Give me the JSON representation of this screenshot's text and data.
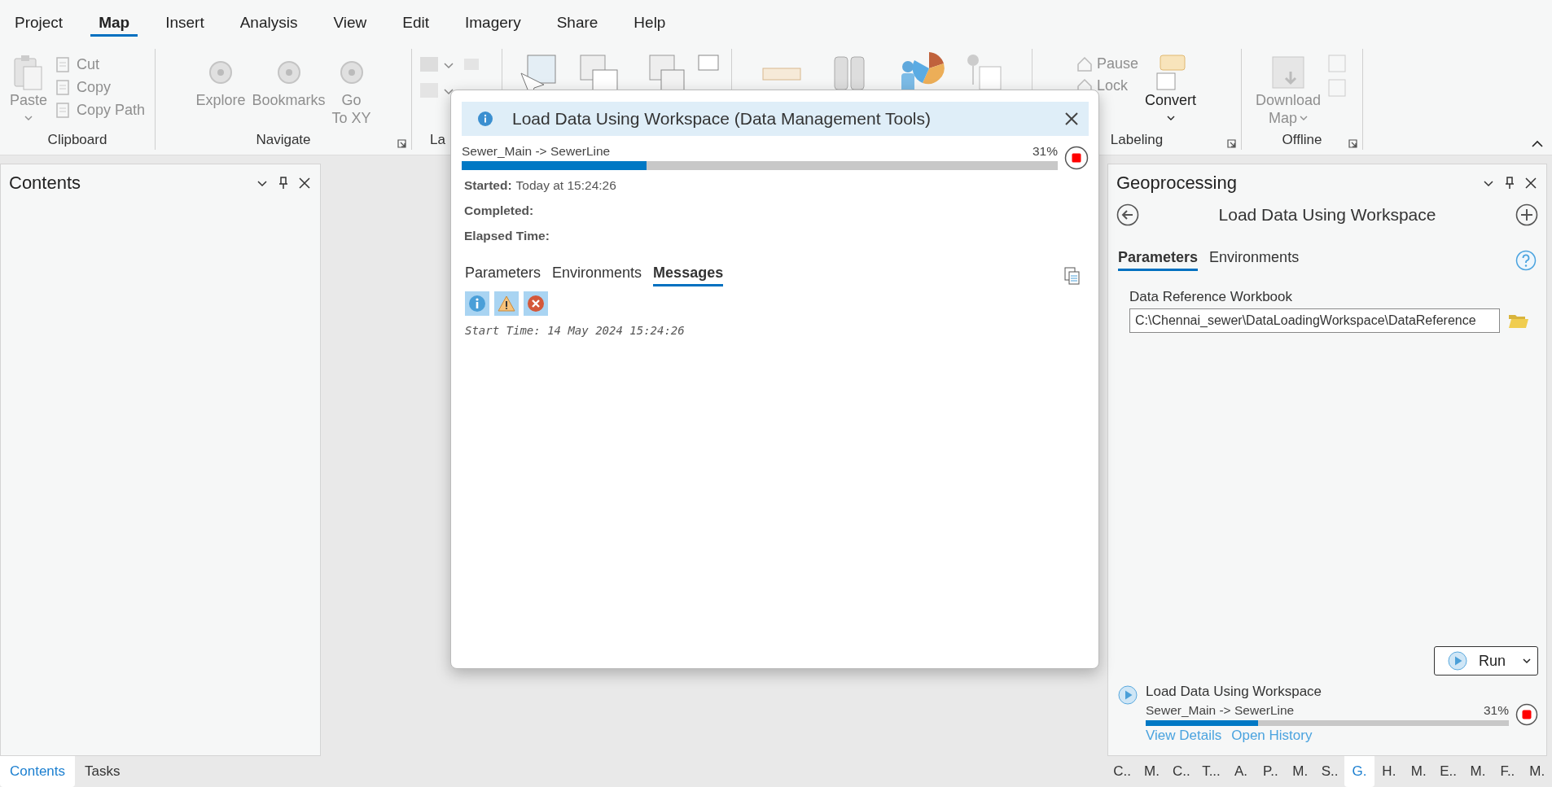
{
  "menu_tabs": [
    {
      "label": "Project",
      "selected": false
    },
    {
      "label": "Map",
      "selected": true
    },
    {
      "label": "Insert",
      "selected": false
    },
    {
      "label": "Analysis",
      "selected": false
    },
    {
      "label": "View",
      "selected": false
    },
    {
      "label": "Edit",
      "selected": false
    },
    {
      "label": "Imagery",
      "selected": false
    },
    {
      "label": "Share",
      "selected": false
    },
    {
      "label": "Help",
      "selected": false
    }
  ],
  "ribbon": {
    "clipboard": {
      "label": "Clipboard",
      "items": [
        {
          "label": "Paste",
          "disabled": true
        },
        {
          "label": "Cut",
          "disabled": true
        },
        {
          "label": "Copy",
          "disabled": true
        },
        {
          "label": "Copy Path",
          "disabled": true
        }
      ]
    },
    "navigate": {
      "label": "Navigate",
      "items": [
        {
          "lines": [
            "Explore"
          ],
          "disabled": true
        },
        {
          "lines": [
            "Bookmarks"
          ],
          "disabled": true
        },
        {
          "lines": [
            "Go",
            "To XY"
          ],
          "disabled": true
        }
      ]
    },
    "layer": {
      "label": "La"
    },
    "labeling": {
      "label": "Labeling",
      "items": [
        {
          "label": "Pause",
          "disabled": true
        },
        {
          "label": "Lock",
          "disabled": true
        },
        {
          "label": "Convert",
          "disabled": false
        }
      ]
    },
    "offline": {
      "label": "Offline",
      "items": [
        {
          "lines": [
            "Download",
            "Map"
          ],
          "disabled": true
        }
      ]
    }
  },
  "contents_pane": {
    "title": "Contents"
  },
  "dialog": {
    "title": "Load Data Using Workspace (Data Management Tools)",
    "task": "Sewer_Main -> SewerLine",
    "percent": "31%",
    "level": 0.31,
    "fields": [
      {
        "label": "Started:",
        "value": "Today at 15:24:26"
      },
      {
        "label": "Completed:"
      },
      {
        "label": "Elapsed Time:"
      }
    ],
    "tabs": [
      {
        "label": "Parameters",
        "selected": false
      },
      {
        "label": "Environments",
        "selected": false
      },
      {
        "label": "Messages",
        "selected": true
      }
    ],
    "filters": [
      {
        "kind": "info",
        "on": true
      },
      {
        "kind": "warning",
        "on": true
      },
      {
        "kind": "error",
        "on": true
      }
    ],
    "messages": [
      "Start Time: 14 May 2024 15:24:26"
    ]
  },
  "geoprocessing": {
    "title": "Geoprocessing",
    "tool": "Load Data Using Workspace",
    "tabs": [
      {
        "label": "Parameters",
        "selected": true
      },
      {
        "label": "Environments",
        "selected": false
      }
    ],
    "parameter": {
      "label": "Data Reference Workbook",
      "value": "C:\\Chennai_sewer\\DataLoadingWorkspace\\DataReference"
    },
    "run": "Run",
    "progress": {
      "tool": "Load Data Using Workspace",
      "task": "Sewer_Main -> SewerLine",
      "percent": "31%",
      "level": 0.31,
      "links": [
        "View Details",
        "Open History"
      ]
    }
  },
  "left_tabs": [
    {
      "label": "Contents",
      "selected": true
    },
    {
      "label": "Tasks",
      "selected": false
    }
  ],
  "right_tabs": [
    {
      "label": "C..",
      "selected": false
    },
    {
      "label": "M.",
      "selected": false
    },
    {
      "label": "C..",
      "selected": false
    },
    {
      "label": "T...",
      "selected": false
    },
    {
      "label": "A.",
      "selected": false
    },
    {
      "label": "P..",
      "selected": false
    },
    {
      "label": "M.",
      "selected": false
    },
    {
      "label": "S..",
      "selected": false
    },
    {
      "label": "G.",
      "selected": true
    },
    {
      "label": "H.",
      "selected": false
    },
    {
      "label": "M.",
      "selected": false
    },
    {
      "label": "E..",
      "selected": false
    },
    {
      "label": "M.",
      "selected": false
    },
    {
      "label": "F..",
      "selected": false
    },
    {
      "label": "M.",
      "selected": false
    }
  ]
}
